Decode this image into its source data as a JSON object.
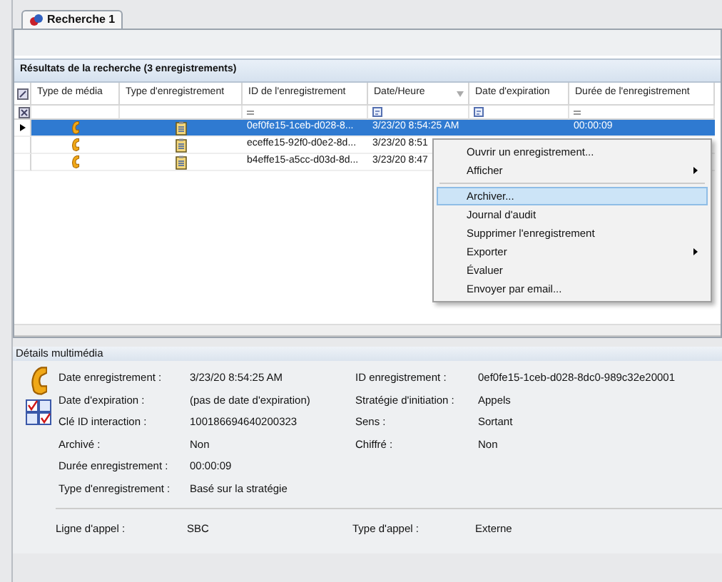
{
  "tab": {
    "label": "Recherche 1",
    "selected": true
  },
  "results": {
    "title": "Résultats de la recherche (3 enregistrements)",
    "columns": [
      {
        "label": "Type de média"
      },
      {
        "label": "Type d'enregistrement"
      },
      {
        "label": "ID de l'enregistrement"
      },
      {
        "label": "Date/Heure",
        "sorted": true
      },
      {
        "label": "Date d'expiration"
      },
      {
        "label": "Durée de l'enregistrement"
      }
    ],
    "filter_row": [
      {
        "kind": "blank"
      },
      {
        "kind": "blank"
      },
      {
        "kind": "equals"
      },
      {
        "kind": "calendar"
      },
      {
        "kind": "calendar"
      },
      {
        "kind": "equals"
      }
    ],
    "rows": [
      {
        "selected": true,
        "id": "0ef0fe15-1ceb-d028-8...",
        "date": "3/23/20 8:54:25 AM",
        "duration": "00:00:09"
      },
      {
        "selected": false,
        "id": "eceffe15-92f0-d0e2-8d...",
        "date": "3/23/20 8:51"
      },
      {
        "selected": false,
        "id": "b4effe15-a5cc-d03d-8d...",
        "date": "3/23/20 8:47"
      }
    ]
  },
  "context_menu": {
    "items": [
      {
        "kind": "item",
        "label": "Ouvrir un enregistrement...",
        "submenu": false,
        "selected": false
      },
      {
        "kind": "item",
        "label": "Afficher",
        "submenu": true,
        "selected": false
      },
      {
        "kind": "separator"
      },
      {
        "kind": "item",
        "label": "Archiver...",
        "submenu": false,
        "selected": true
      },
      {
        "kind": "item",
        "label": "Journal d'audit",
        "submenu": false,
        "selected": false
      },
      {
        "kind": "item",
        "label": "Supprimer l'enregistrement",
        "submenu": false,
        "selected": false
      },
      {
        "kind": "item",
        "label": "Exporter",
        "submenu": true,
        "selected": false
      },
      {
        "kind": "item",
        "label": "Évaluer",
        "submenu": false,
        "selected": false
      },
      {
        "kind": "item",
        "label": "Envoyer par email...",
        "submenu": false,
        "selected": false
      }
    ]
  },
  "details": {
    "title": "Détails multimédia",
    "left": [
      {
        "label": "Date enregistrement :",
        "value": "3/23/20 8:54:25 AM"
      },
      {
        "label": "Date d'expiration :",
        "value": "(pas de date d'expiration)"
      },
      {
        "label": "Clé ID interaction :",
        "value": "100186694640200323"
      },
      {
        "label": "Archivé :",
        "value": "Non"
      },
      {
        "label": "Durée enregistrement :",
        "value": "00:00:09"
      },
      {
        "label": "Type d'enregistrement :",
        "value": "Basé sur la stratégie"
      }
    ],
    "right": [
      {
        "label": "ID enregistrement :",
        "value": "0ef0fe15-1ceb-d028-8dc0-989c32e20001"
      },
      {
        "label": "Stratégie d'initiation :",
        "value": "Appels"
      },
      {
        "label": "Sens :",
        "value": "Sortant"
      },
      {
        "label": "Chiffré :",
        "value": "Non"
      }
    ],
    "footer": [
      {
        "label": "Ligne d'appel :",
        "value": "SBC"
      },
      {
        "label": "Type d'appel :",
        "value": "Externe"
      }
    ]
  }
}
